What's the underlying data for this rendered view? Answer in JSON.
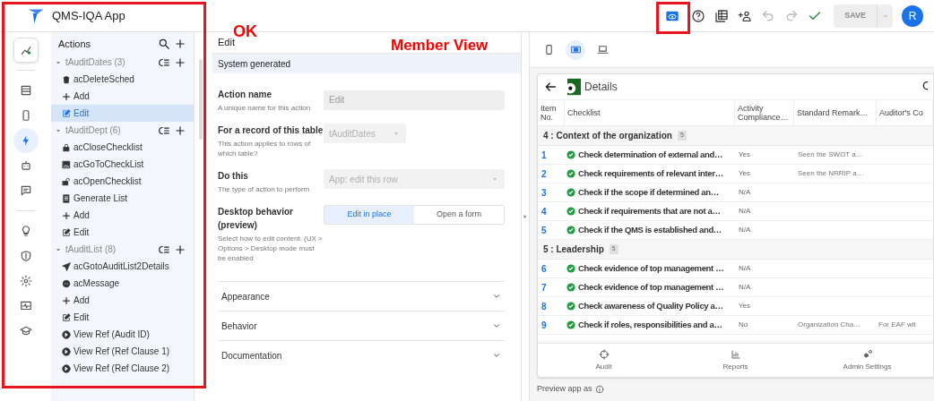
{
  "app": {
    "title": "QMS-IQA App"
  },
  "toolbar": {
    "save": {
      "label": "SAVE",
      "disabled": true
    },
    "avatar": "R"
  },
  "annotations": [
    {
      "text": "OK"
    },
    {
      "text": "Member View"
    }
  ],
  "rail": {
    "groups": [
      {
        "items": [
          {
            "kind": "automation",
            "selected": false
          }
        ]
      },
      {
        "items": [
          {
            "kind": "data",
            "selected": false
          },
          {
            "kind": "views",
            "selected": false
          },
          {
            "kind": "actions",
            "selected": true
          },
          {
            "kind": "bots",
            "selected": false
          },
          {
            "kind": "chat",
            "selected": false
          }
        ]
      },
      {
        "items": [
          {
            "kind": "ideas",
            "selected": false
          },
          {
            "kind": "security",
            "selected": false
          },
          {
            "kind": "settings",
            "selected": false
          },
          {
            "kind": "monitor",
            "selected": false
          },
          {
            "kind": "learn",
            "selected": false
          }
        ]
      }
    ]
  },
  "actions": {
    "title": "Actions",
    "groups": [
      {
        "table": "tAuditDates",
        "count": "(3)",
        "expanded": true,
        "items": [
          {
            "kind": "delete",
            "label": "acDeleteSched",
            "selected": false
          },
          {
            "kind": "add",
            "label": "Add",
            "selected": false
          },
          {
            "kind": "edit",
            "label": "Edit",
            "selected": true
          }
        ]
      },
      {
        "table": "tAuditDept",
        "count": "(6)",
        "expanded": true,
        "items": [
          {
            "kind": "lock",
            "label": "acCloseChecklist",
            "selected": false
          },
          {
            "kind": "image",
            "label": "acGoToCheckList",
            "selected": false
          },
          {
            "kind": "unlock",
            "label": "acOpenChecklist",
            "selected": false
          },
          {
            "kind": "doc",
            "label": "Generate List",
            "selected": false
          },
          {
            "kind": "add",
            "label": "Add",
            "selected": false
          },
          {
            "kind": "edit",
            "label": "Edit",
            "selected": false
          }
        ]
      },
      {
        "table": "tAuditList",
        "count": "(8)",
        "expanded": true,
        "items": [
          {
            "kind": "send",
            "label": "acGotoAuditList2Details",
            "selected": false
          },
          {
            "kind": "message",
            "label": "acMessage",
            "selected": false
          },
          {
            "kind": "add",
            "label": "Add",
            "selected": false
          },
          {
            "kind": "edit",
            "label": "Edit",
            "selected": false
          },
          {
            "kind": "view",
            "label": "View Ref (Audit ID)",
            "selected": false
          },
          {
            "kind": "view",
            "label": "View Ref (Ref Clause 1)",
            "selected": false
          },
          {
            "kind": "view",
            "label": "View Ref (Ref Clause 2)",
            "selected": false
          }
        ]
      }
    ]
  },
  "editor": {
    "title": "Edit",
    "banner": "System generated",
    "fields": [
      {
        "kind": "text",
        "label": "Action name",
        "help": "A unique name for this action",
        "value": "Edit",
        "disabled": true,
        "wide": true
      },
      {
        "kind": "dropdown",
        "label": "For a record of this table",
        "help": "This action applies to rows of which table?",
        "value": "tAuditDates",
        "disabled": true,
        "wide": false
      },
      {
        "kind": "dropdown",
        "label": "Do this",
        "help": "The type of action to perform",
        "value": "App: edit this row",
        "disabled": true,
        "wide": true
      },
      {
        "kind": "toggle",
        "label": "Desktop behavior (preview)",
        "help": "Select how to edit content. (UX > Options > Desktop mode must be enabled",
        "options": [
          {
            "label": "Edit in place",
            "selected": true
          },
          {
            "label": "Open a form",
            "selected": false
          }
        ]
      }
    ],
    "sections": [
      {
        "label": "Appearance",
        "expanded": false
      },
      {
        "label": "Behavior",
        "expanded": false
      },
      {
        "label": "Documentation",
        "expanded": false
      }
    ]
  },
  "preview": {
    "devices": [
      {
        "kind": "phone",
        "selected": false
      },
      {
        "kind": "tablet",
        "selected": true
      },
      {
        "kind": "laptop",
        "selected": false
      }
    ],
    "screen": {
      "title": "Details",
      "columns": [
        "Item No.",
        "Checklist",
        "Activity Compliance…",
        "Standard Remark…",
        "Auditor's Co"
      ],
      "groups": [
        {
          "label": "4 : Context of the organization",
          "count": "5",
          "rows": [
            {
              "item_no": "1",
              "checklist": "Check determination of external and…",
              "compliance": "Yes",
              "remark": "Seen the SWOT a…"
            },
            {
              "item_no": "2",
              "checklist": "Check requirements of relevant inter…",
              "compliance": "Yes",
              "remark": "Seen the NRRIP a…"
            },
            {
              "item_no": "3",
              "checklist": "Check if the scope if determined an…",
              "compliance": "N/A"
            },
            {
              "item_no": "4",
              "checklist": "Check if requirements that are not a…",
              "compliance": "N/A"
            },
            {
              "item_no": "5",
              "checklist": "Check if the QMS is established and…",
              "compliance": "N/A"
            }
          ]
        },
        {
          "label": "5 : Leadership",
          "count": "5",
          "rows": [
            {
              "item_no": "6",
              "checklist": "Check evidence of top management …",
              "compliance": "N/A"
            },
            {
              "item_no": "7",
              "checklist": "Check evidence of top management …",
              "compliance": "N/A"
            },
            {
              "item_no": "8",
              "checklist": "Check awareness of Quality Policy a…",
              "compliance": "Yes"
            },
            {
              "item_no": "9",
              "checklist": "Check if roles, responsibilities and a…",
              "compliance": "No",
              "remark": "Organization Cha…",
              "auditor": "For EAF wit"
            }
          ]
        }
      ],
      "nav": [
        {
          "kind": "audit",
          "label": "Audit"
        },
        {
          "kind": "reports",
          "label": "Reports"
        },
        {
          "kind": "admin",
          "label": "Admin Settings"
        }
      ]
    },
    "preview_as": "Preview app as"
  }
}
